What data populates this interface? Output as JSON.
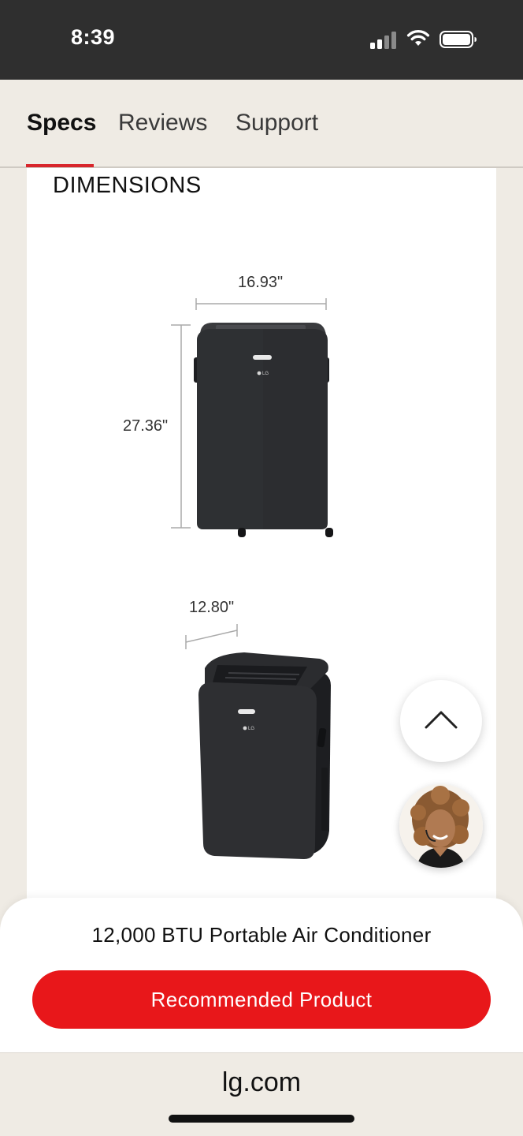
{
  "status_bar": {
    "time": "8:39",
    "icons": [
      "cellular-signal-icon",
      "wifi-icon",
      "battery-icon"
    ]
  },
  "tabs": [
    {
      "label": "Specs",
      "active": true
    },
    {
      "label": "Reviews",
      "active": false
    },
    {
      "label": "Support",
      "active": false
    }
  ],
  "dimensions": {
    "title": "DIMENSIONS",
    "width": "16.93\"",
    "height": "27.36\"",
    "depth": "12.80\"",
    "brand_mark": "LG"
  },
  "floating": {
    "scroll_top_icon": "chevron-up-icon",
    "chat_icon": "agent-avatar"
  },
  "bottom_sheet": {
    "product_name": "12,000 BTU Portable Air Conditioner",
    "button_label": "Recommended Product"
  },
  "browser": {
    "url": "lg.com"
  },
  "colors": {
    "accent": "#e8171a",
    "tab_underline": "#d8262c",
    "background": "#efebe4",
    "status_bar": "#2f2f2f",
    "unit_body": "#2c2d30"
  }
}
